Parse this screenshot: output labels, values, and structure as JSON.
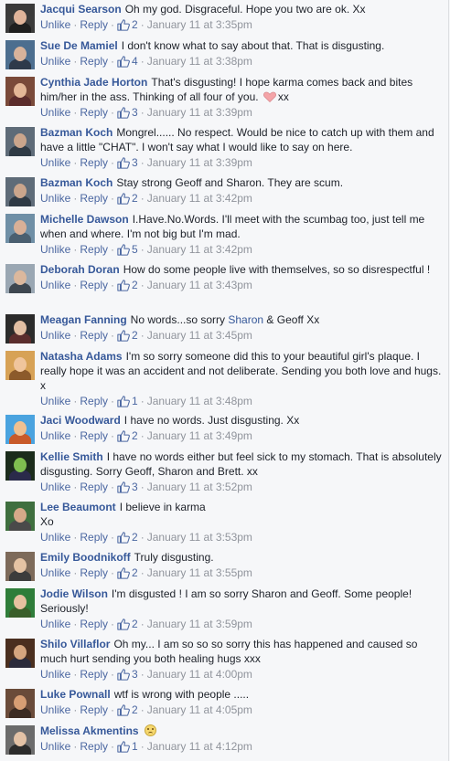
{
  "labels": {
    "unlike": "Unlike",
    "reply": "Reply",
    "sep": "·"
  },
  "comments": [
    {
      "author": "Jacqui Searson",
      "text": "Oh my god. Disgraceful. Hope you two are ok. Xx",
      "likes": "2",
      "time": "January 11 at 3:35pm"
    },
    {
      "author": "Sue De Mamiel",
      "text": "I don't know what to say about that. That is disgusting.",
      "likes": "4",
      "time": "January 11 at 3:38pm"
    },
    {
      "author": "Cynthia Jade Horton",
      "text": "That's disgusting! I hope karma comes back and bites him/her in the ass. Thinking of all four of you.",
      "text_after": "xx",
      "likes": "3",
      "time": "January 11 at 3:39pm"
    },
    {
      "author": "Bazman Koch",
      "text": "Mongrel...... No respect. Would be nice to catch up with them and have a little \"CHAT\". I won't say what I would like to say on here.",
      "likes": "3",
      "time": "January 11 at 3:39pm"
    },
    {
      "author": "Bazman Koch",
      "text": "Stay strong Geoff and Sharon. They are scum.",
      "likes": "2",
      "time": "January 11 at 3:42pm"
    },
    {
      "author": "Michelle Dawson",
      "text": "I.Have.No.Words. I'll meet with the scumbag too, just tell me when and where. I'm not big but I'm mad.",
      "likes": "5",
      "time": "January 11 at 3:42pm"
    },
    {
      "author": "Deborah Doran",
      "text": "How do some people live with themselves, so so disrespectful !",
      "likes": "2",
      "time": "January 11 at 3:43pm"
    },
    {
      "author": "Meagan Fanning",
      "text": "No words...so sorry",
      "tag": "Sharon",
      "text_after": "& Geoff Xx",
      "likes": "2",
      "time": "January 11 at 3:45pm"
    },
    {
      "author": "Natasha Adams",
      "text": "I'm so sorry someone did this to your beautiful girl's plaque. I really hope it was an accident and not deliberate. Sending you both love and hugs. x",
      "likes": "1",
      "time": "January 11 at 3:48pm"
    },
    {
      "author": "Jaci Woodward",
      "text": "I have no words. Just disgusting. Xx",
      "likes": "2",
      "time": "January 11 at 3:49pm"
    },
    {
      "author": "Kellie Smith",
      "text": "I have no words either but feel sick to my stomach. That is absolutely disgusting. Sorry Geoff, Sharon and Brett. xx",
      "likes": "3",
      "time": "January 11 at 3:52pm"
    },
    {
      "author": "Lee Beaumont",
      "text": "I believe in karma",
      "text_line2": "Xo",
      "likes": "2",
      "time": "January 11 at 3:53pm"
    },
    {
      "author": "Emily Boodnikoff",
      "text": "Truly disgusting.",
      "likes": "2",
      "time": "January 11 at 3:55pm"
    },
    {
      "author": "Jodie Wilson",
      "text": "I'm disgusted ! I am so sorry Sharon and Geoff. Some people! Seriously!",
      "likes": "2",
      "time": "January 11 at 3:59pm"
    },
    {
      "author": "Shilo Villaflor",
      "text": "Oh my... I am so so so sorry this has happened and caused so much hurt sending you both healing hugs xxx",
      "likes": "3",
      "time": "January 11 at 4:00pm"
    },
    {
      "author": "Luke Pownall",
      "text": "wtf is wrong with people .....",
      "likes": "2",
      "time": "January 11 at 4:05pm"
    },
    {
      "author": "Melissa Akmentins",
      "text": "",
      "likes": "1",
      "time": "January 11 at 4:12pm"
    }
  ],
  "colors": {
    "name": "#365899",
    "link": "#4b67a1",
    "meta": "#90949c",
    "text": "#1d2129",
    "background": "#f6f7f9"
  },
  "icons": {
    "like": "thumbs-up-icon",
    "heart": "heart-emoji-icon",
    "frown": "frown-emoji-icon",
    "avatar": "avatar-icon"
  }
}
